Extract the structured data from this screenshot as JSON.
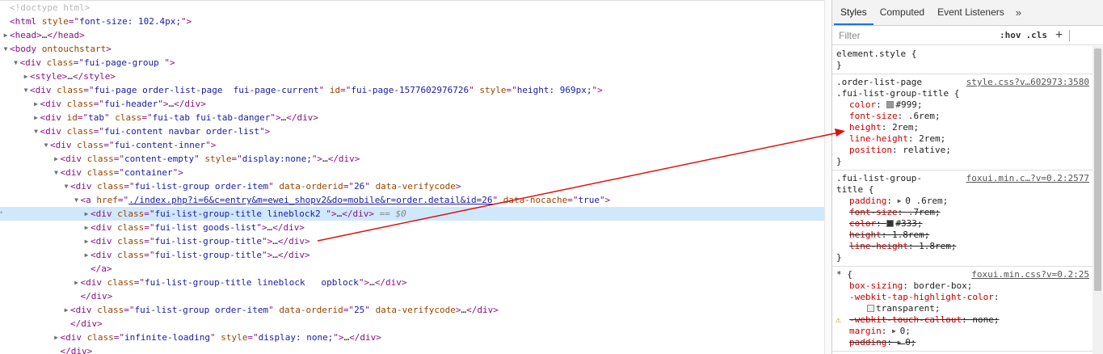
{
  "dom_lines": [
    {
      "indent": 0,
      "tri": "",
      "html": "<span class='comment'>&lt;!doctype html&gt;</span>"
    },
    {
      "indent": 0,
      "tri": "",
      "html": "<span class='tag'>&lt;html</span> <span class='attr-n'>style</span><span class='tag'>=\"</span><span class='attr-v'>font-size: 102.4px;</span><span class='tag'>\"&gt;</span>"
    },
    {
      "indent": 0,
      "tri": "▶",
      "html": "<span class='tag'>&lt;head&gt;</span><span class='text'>…</span><span class='tag'>&lt;/head&gt;</span>"
    },
    {
      "indent": 0,
      "tri": "▼",
      "html": "<span class='tag'>&lt;body</span> <span class='attr-n'>ontouchstart</span><span class='tag'>&gt;</span>"
    },
    {
      "indent": 1,
      "tri": "▼",
      "html": "<span class='tag'>&lt;div</span> <span class='attr-n'>class</span><span class='tag'>=\"</span><span class='attr-v'>fui-page-group </span><span class='tag'>\"&gt;</span>"
    },
    {
      "indent": 2,
      "tri": "▶",
      "html": "<span class='tag'>&lt;style&gt;</span><span class='text'>…</span><span class='tag'>&lt;/style&gt;</span>"
    },
    {
      "indent": 2,
      "tri": "▼",
      "html": "<span class='tag'>&lt;div</span> <span class='attr-n'>class</span><span class='tag'>=\"</span><span class='attr-v'>fui-page order-list-page  fui-page-current</span><span class='tag'>\"</span> <span class='attr-n'>id</span><span class='tag'>=\"</span><span class='attr-v'>fui-page-1577602976726</span><span class='tag'>\"</span> <span class='attr-n'>style</span><span class='tag'>=\"</span><span class='attr-v'>height: 969px;</span><span class='tag'>\"&gt;</span>"
    },
    {
      "indent": 3,
      "tri": "▶",
      "html": "<span class='tag'>&lt;div</span> <span class='attr-n'>class</span><span class='tag'>=\"</span><span class='attr-v'>fui-header</span><span class='tag'>\"&gt;</span><span class='text'>…</span><span class='tag'>&lt;/div&gt;</span>"
    },
    {
      "indent": 3,
      "tri": "▶",
      "html": "<span class='tag'>&lt;div</span> <span class='attr-n'>id</span><span class='tag'>=\"</span><span class='attr-v'>tab</span><span class='tag'>\"</span> <span class='attr-n'>class</span><span class='tag'>=\"</span><span class='attr-v'>fui-tab fui-tab-danger</span><span class='tag'>\"&gt;</span><span class='text'>…</span><span class='tag'>&lt;/div&gt;</span>"
    },
    {
      "indent": 3,
      "tri": "▼",
      "html": "<span class='tag'>&lt;div</span> <span class='attr-n'>class</span><span class='tag'>=\"</span><span class='attr-v'>fui-content navbar order-list</span><span class='tag'>\"&gt;</span>"
    },
    {
      "indent": 4,
      "tri": "▼",
      "html": "<span class='tag'>&lt;div</span> <span class='attr-n'>class</span><span class='tag'>=\"</span><span class='attr-v'>fui-content-inner</span><span class='tag'>\"&gt;</span>"
    },
    {
      "indent": 5,
      "tri": "▶",
      "html": "<span class='tag'>&lt;div</span> <span class='attr-n'>class</span><span class='tag'>=\"</span><span class='attr-v'>content-empty</span><span class='tag'>\"</span> <span class='attr-n'>style</span><span class='tag'>=\"</span><span class='attr-v'>display:none;</span><span class='tag'>\"&gt;</span><span class='text'>…</span><span class='tag'>&lt;/div&gt;</span>"
    },
    {
      "indent": 5,
      "tri": "▼",
      "html": "<span class='tag'>&lt;div</span> <span class='attr-n'>class</span><span class='tag'>=\"</span><span class='attr-v'>container</span><span class='tag'>\"&gt;</span>"
    },
    {
      "indent": 6,
      "tri": "▼",
      "html": "<span class='tag'>&lt;div</span> <span class='attr-n'>class</span><span class='tag'>=\"</span><span class='attr-v'>fui-list-group order-item</span><span class='tag'>\"</span> <span class='attr-n'>data-orderid</span><span class='tag'>=\"</span><span class='attr-v'>26</span><span class='tag'>\"</span> <span class='attr-n'>data-verifycode</span><span class='tag'>&gt;</span>"
    },
    {
      "indent": 7,
      "tri": "▼",
      "html": "<span class='tag'>&lt;a</span> <span class='attr-n'>href</span><span class='tag'>=\"</span><span class='link'>./index.php?i=6&amp;c=entry&amp;m=ewei_shopv2&amp;do=mobile&amp;r=order.detail&amp;id=26</span><span class='tag'>\"</span> <span class='attr-n'>data-nocache</span><span class='tag'>=\"</span><span class='attr-v'>true</span><span class='tag'>\"&gt;</span>"
    },
    {
      "indent": 8,
      "tri": "▶",
      "selected": true,
      "html": "<span class='tag'>&lt;div</span> <span class='attr-n'>class</span><span class='tag'>=\"</span><span class='attr-v'>fui-list-group-title lineblock2 </span><span class='tag'>\"&gt;</span><span class='text'>…</span><span class='tag'>&lt;/div&gt;</span> <span class='dim'>== $0</span>"
    },
    {
      "indent": 8,
      "tri": "▶",
      "html": "<span class='tag'>&lt;div</span> <span class='attr-n'>class</span><span class='tag'>=\"</span><span class='attr-v'>fui-list goods-list</span><span class='tag'>\"&gt;</span><span class='text'>…</span><span class='tag'>&lt;/div&gt;</span>"
    },
    {
      "indent": 8,
      "tri": "▶",
      "html": "<span class='tag'>&lt;div</span> <span class='attr-n'>class</span><span class='tag'>=\"</span><span class='attr-v'>fui-list-group-title</span><span class='tag'>\"&gt;</span><span class='text'>…</span><span class='tag'>&lt;/div&gt;</span>"
    },
    {
      "indent": 8,
      "tri": "▶",
      "html": "<span class='tag'>&lt;div</span> <span class='attr-n'>class</span><span class='tag'>=\"</span><span class='attr-v'>fui-list-group-title</span><span class='tag'>\"&gt;</span><span class='text'>…</span><span class='tag'>&lt;/div&gt;</span>"
    },
    {
      "indent": 8,
      "tri": "",
      "html": "<span class='tag'>&lt;/a&gt;</span>"
    },
    {
      "indent": 7,
      "tri": "▶",
      "html": "<span class='tag'>&lt;div</span> <span class='attr-n'>class</span><span class='tag'>=\"</span><span class='attr-v'>fui-list-group-title lineblock   opblock</span><span class='tag'>\"&gt;</span><span class='text'>…</span><span class='tag'>&lt;/div&gt;</span>"
    },
    {
      "indent": 7,
      "tri": "",
      "html": "<span class='tag'>&lt;/div&gt;</span>"
    },
    {
      "indent": 6,
      "tri": "▶",
      "html": "<span class='tag'>&lt;div</span> <span class='attr-n'>class</span><span class='tag'>=\"</span><span class='attr-v'>fui-list-group order-item</span><span class='tag'>\"</span> <span class='attr-n'>data-orderid</span><span class='tag'>=\"</span><span class='attr-v'>25</span><span class='tag'>\"</span> <span class='attr-n'>data-verifycode</span><span class='tag'>&gt;</span><span class='text'>…</span><span class='tag'>&lt;/div&gt;</span>"
    },
    {
      "indent": 6,
      "tri": "",
      "html": "<span class='tag'>&lt;/div&gt;</span>"
    },
    {
      "indent": 5,
      "tri": "▶",
      "html": "<span class='tag'>&lt;div</span> <span class='attr-n'>class</span><span class='tag'>=\"</span><span class='attr-v'>infinite-loading</span><span class='tag'>\"</span> <span class='attr-n'>style</span><span class='tag'>=\"</span><span class='attr-v'>display: none;</span><span class='tag'>\"&gt;</span><span class='text'>…</span><span class='tag'>&lt;/div&gt;</span>"
    },
    {
      "indent": 5,
      "tri": "",
      "html": "<span class='tag'>&lt;/div&gt;</span>"
    }
  ],
  "selected_suffix": "== $0",
  "tabs": [
    "Styles",
    "Computed",
    "Event Listeners"
  ],
  "tabs_more": "»",
  "filter": {
    "placeholder": "Filter",
    "hov": ":hov",
    "cls": ".cls",
    "plus": "+"
  },
  "rules": [
    {
      "selector_lines": [
        "element.style {"
      ],
      "source": "",
      "decls": [],
      "close": "}"
    },
    {
      "selector_lines": [
        ".order-list-page",
        ".fui-list-group-title {"
      ],
      "source": "style.css?v…602973:3580",
      "decls": [
        {
          "name": "color",
          "value": "#999;",
          "swatch": "#999999"
        },
        {
          "name": "font-size",
          "value": ".6rem;"
        },
        {
          "name": "height",
          "value": "2rem;"
        },
        {
          "name": "line-height",
          "value": "2rem;"
        },
        {
          "name": "position",
          "value": "relative;"
        }
      ],
      "close": "}"
    },
    {
      "selector_lines": [
        ".fui-list-group-",
        "title {"
      ],
      "source": "foxui.min.c…?v=0.2:2577",
      "decls": [
        {
          "name": "padding",
          "value": "0 .6rem;",
          "expand": true
        },
        {
          "name": "font-size",
          "value": ".7rem;",
          "struck": true
        },
        {
          "name": "color",
          "value": "#333;",
          "swatch": "#333333",
          "struck": true
        },
        {
          "name": "height",
          "value": "1.8rem;",
          "struck": true
        },
        {
          "name": "line-height",
          "value": "1.8rem;",
          "struck": true
        }
      ],
      "close": "}"
    },
    {
      "selector_lines": [
        "* {"
      ],
      "source": "foxui.min.css?v=0.2:25",
      "decls": [
        {
          "name": "box-sizing",
          "value": "border-box;"
        },
        {
          "name": "-webkit-tap-highlight-color",
          "value": ""
        },
        {
          "name": "",
          "value": "transparent;",
          "swatch": "transparent",
          "sub": true
        },
        {
          "name": "-webkit-touch-callout",
          "value": "none;",
          "struck": true,
          "warn": true
        },
        {
          "name": "margin",
          "value": "0;",
          "expand": true
        },
        {
          "name": "padding",
          "value": "0;",
          "expand": true,
          "struck": true
        }
      ],
      "close": ""
    }
  ],
  "colors": {
    "selection": "#cfe8fc",
    "tab_active": "#1a73e8",
    "arrow": "#dd1111"
  }
}
